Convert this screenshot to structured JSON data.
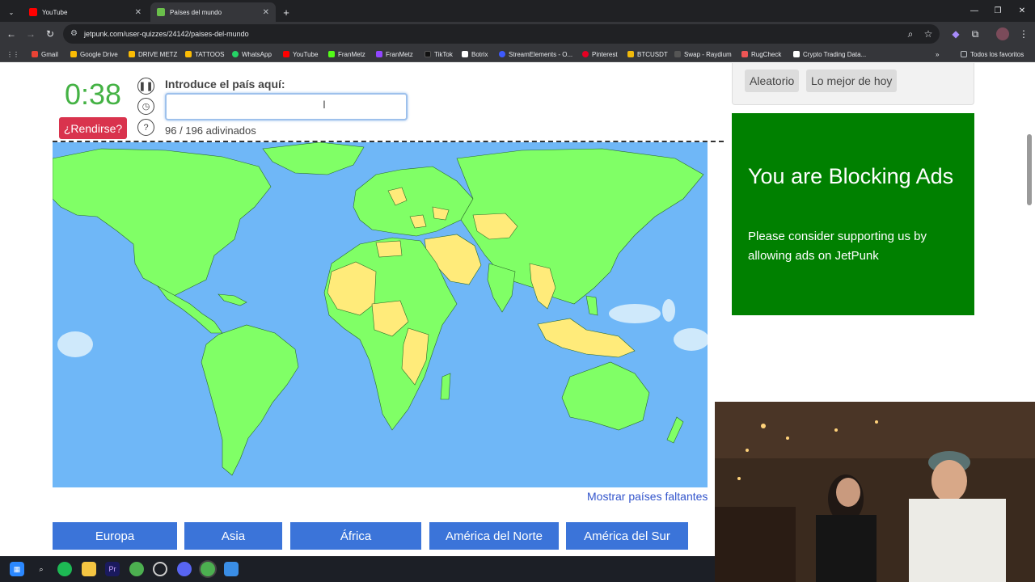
{
  "browser": {
    "tabs": [
      {
        "title": "YouTube",
        "active": false
      },
      {
        "title": "Países del mundo",
        "active": true
      }
    ],
    "url": "jetpunk.com/user-quizzes/24142/paises-del-mundo",
    "bookmarks": [
      "Gmail",
      "Google Drive",
      "DRIVE METZ",
      "TATTOOS",
      "WhatsApp",
      "YouTube",
      "FranMetz",
      "FranMetz",
      "TikTok",
      "Botrix",
      "StreamElements - O...",
      "Pinterest",
      "BTCUSDT",
      "Swap - Raydium",
      "RugCheck",
      "Crypto Trading Data...",
      "Todos los favoritos"
    ]
  },
  "quiz": {
    "timer": "0:38",
    "prompt": "Introduce el país aquí:",
    "answer_value": "",
    "give_up": "¿Rendirse?",
    "progress": "96 / 196 adivinados",
    "show_missing": "Mostrar países faltantes",
    "regions": [
      "Europa",
      "Asia",
      "África",
      "América del Norte",
      "América del Sur"
    ]
  },
  "sidebar": {
    "buttons": [
      "Aleatorio",
      "Lo mejor de hoy"
    ],
    "ad": {
      "title": "You are Blocking Ads",
      "body": "Please consider supporting us by allowing ads on JetPunk"
    }
  },
  "colors": {
    "ocean": "#6fb7f7",
    "land_guessed": "#80ff66",
    "land_unguessed": "#ffeb7a",
    "ad_green": "#008000",
    "give_up_red": "#d9334d",
    "region_blue": "#3b74d9",
    "timer_green": "#44b244"
  }
}
